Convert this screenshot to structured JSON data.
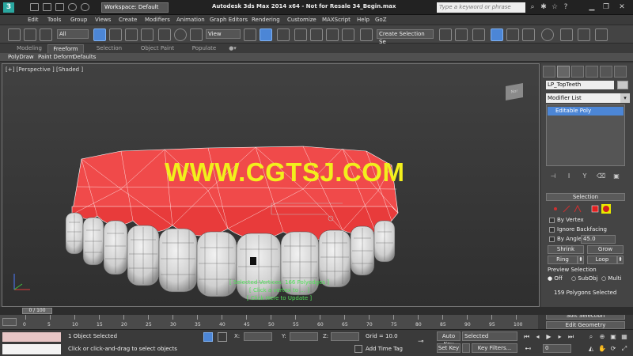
{
  "app": {
    "logo_letter": "3",
    "workspace_label": "Workspace: Default",
    "window_title": "Autodesk 3ds Max  2014 x64  - Not for Resale   34_Begin.max",
    "search_placeholder": "Type a keyword or phrase"
  },
  "menu": [
    "Edit",
    "Tools",
    "Group",
    "Views",
    "Create",
    "Modifiers",
    "Animation",
    "Graph Editors",
    "Rendering",
    "Customize",
    "MAXScript",
    "Help",
    "GoZ"
  ],
  "toolbar": {
    "selection_filter": "All",
    "ref_coord": "View",
    "named_selection": "Create Selection Se"
  },
  "ribbon": {
    "tabs": [
      "Modeling",
      "Freeform",
      "Selection",
      "Object Paint",
      "Populate"
    ],
    "active_tab": "Freeform",
    "buttons": [
      "PolyDraw",
      "Paint Deform",
      "Defaults"
    ]
  },
  "viewport": {
    "label": "[+] [Perspective ] [Shaded ]",
    "viewcube_label": "Nor",
    "watermark": "WWW.CGTSJ.COM",
    "messages": [
      "[ Selected Vertices: 166 Polyedges ]",
      "[ Click a vertex to ... ]",
      "[ Click Here to Update ]"
    ]
  },
  "command_panel": {
    "object_name": "LP_TopTeeth",
    "modifier_list": "Modifier List",
    "stack_item": "Editable Poly",
    "selection": {
      "header": "Selection",
      "by_vertex": "By Vertex",
      "ignore_backfacing": "Ignore Backfacing",
      "by_angle": "By Angle:",
      "angle_value": "45.0",
      "shrink": "Shrink",
      "grow": "Grow",
      "ring": "Ring",
      "loop": "Loop",
      "preview_title": "Preview Selection",
      "preview_options": [
        "Off",
        "SubObj",
        "Multi"
      ],
      "status": "159 Polygons Selected"
    },
    "soft_selection": "Soft Selection",
    "edit_geometry": "Edit Geometry"
  },
  "timeline": {
    "slider": "0 / 100",
    "ticks": [
      "0",
      "5",
      "10",
      "15",
      "20",
      "25",
      "30",
      "35",
      "40",
      "45",
      "50",
      "55",
      "60",
      "65",
      "70",
      "75",
      "80",
      "85",
      "90",
      "95",
      "100"
    ]
  },
  "status": {
    "selected": "1 Object Selected",
    "prompt": "Click or click-and-drag to select objects",
    "x_label": "X:",
    "y_label": "Y:",
    "z_label": "Z:",
    "grid": "Grid = 10.0",
    "add_time_tag": "Add Time Tag",
    "auto_key": "Auto Key",
    "set_key": "Set Key",
    "key_mode": "Selected",
    "key_filters": "Key Filters...",
    "frame": "0"
  }
}
